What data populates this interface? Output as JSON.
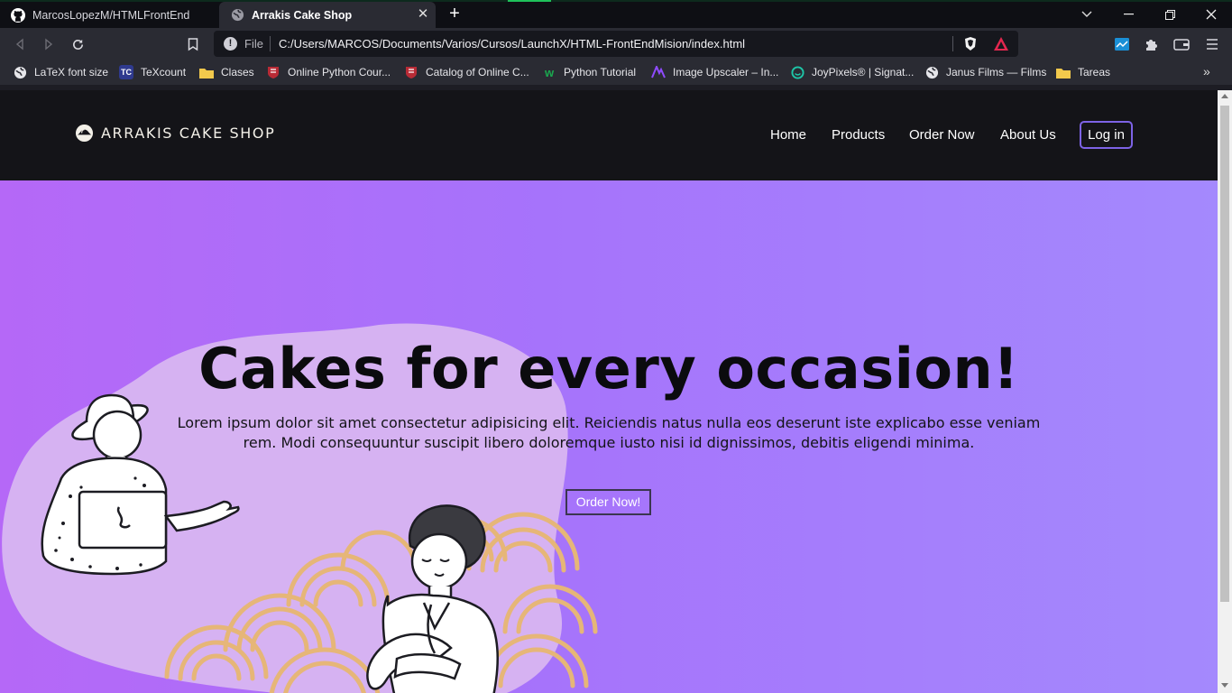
{
  "browser": {
    "tabs": [
      {
        "title": "MarcosLopezM/HTMLFrontEnd",
        "icon": "github-icon",
        "active": false
      },
      {
        "title": "Arrakis Cake Shop",
        "icon": "globe-icon",
        "active": true
      }
    ],
    "address": {
      "scheme_label": "File",
      "url": "C:/Users/MARCOS/Documents/Varios/Cursos/LaunchX/HTML-FrontEndMision/index.html"
    },
    "bookmarks": [
      {
        "label": "LaTeX font size",
        "icon": "globe-icon"
      },
      {
        "label": "TeXcount",
        "icon": "texcount-icon"
      },
      {
        "label": "Clases",
        "icon": "folder-icon"
      },
      {
        "label": "Online Python Cour...",
        "icon": "harvard-icon"
      },
      {
        "label": "Catalog of Online C...",
        "icon": "harvard-icon"
      },
      {
        "label": "Python Tutorial",
        "icon": "w3-icon"
      },
      {
        "label": "Image Upscaler – In...",
        "icon": "upscaler-icon"
      },
      {
        "label": "JoyPixels® | Signat...",
        "icon": "joypixels-icon"
      },
      {
        "label": "Janus Films — Films",
        "icon": "globe-icon"
      },
      {
        "label": "Tareas",
        "icon": "folder-icon"
      }
    ]
  },
  "site": {
    "brand": "ARRAKIS CAKE SHOP",
    "nav": [
      "Home",
      "Products",
      "Order Now",
      "About Us"
    ],
    "login_label": "Log in",
    "hero": {
      "title": "Cakes for every occasion!",
      "text": "Lorem ipsum dolor sit amet consectetur adipisicing elit. Reiciendis natus nulla eos deserunt iste explicabo esse veniam rem. Modi consequuntur suscipit libero doloremque iusto nisi id dignissimos, debitis eligendi minima.",
      "cta_label": "Order Now!"
    }
  },
  "colors": {
    "header_bg": "#141418",
    "hero_gradient_start": "#b568f7",
    "hero_gradient_end": "#a489fd",
    "login_border": "#7d63e6",
    "blob": "#d6b2f2",
    "swirl": "#e6b678"
  }
}
